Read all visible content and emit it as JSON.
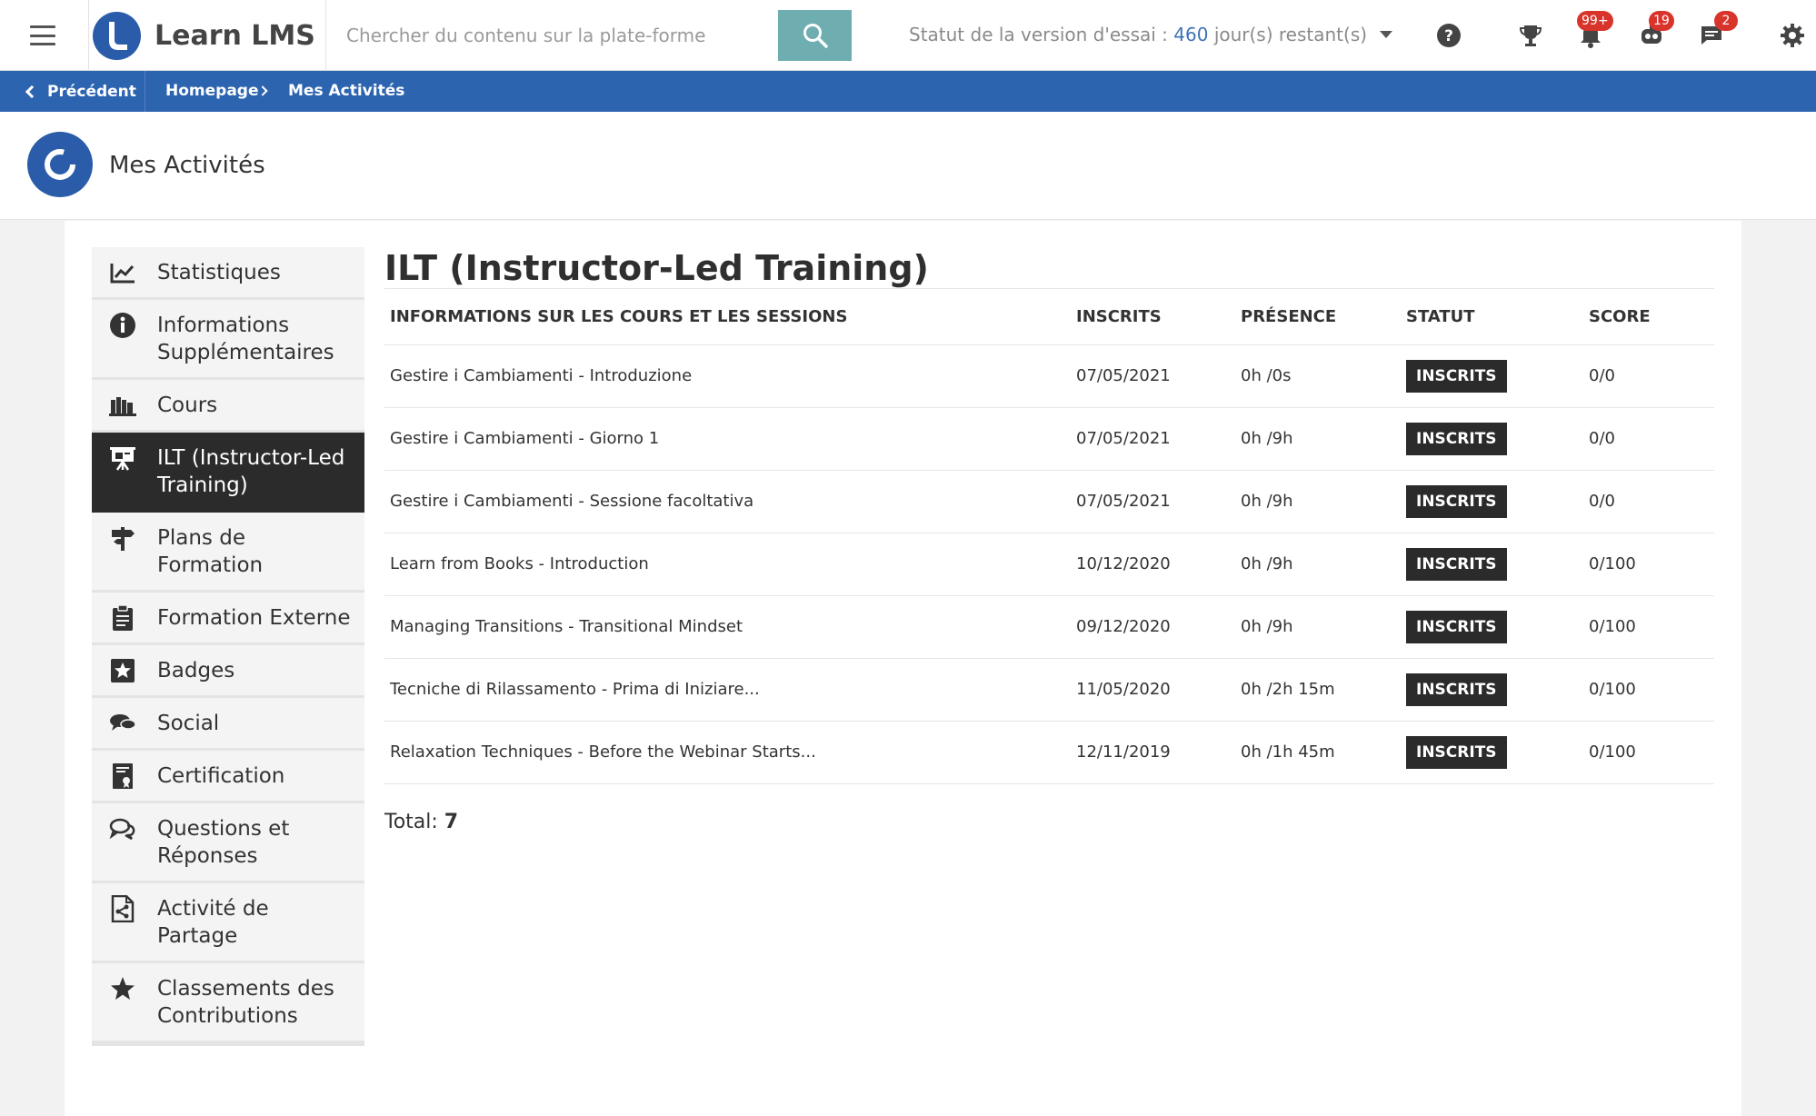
{
  "header": {
    "brand": "Learn LMS",
    "search_placeholder": "Chercher du contenu sur la plate-forme",
    "trial_prefix": "Statut de la version d'essai :",
    "trial_days": "460",
    "trial_suffix": "jour(s) restant(s)",
    "notif_badges": {
      "bell": "99+",
      "robot": "19",
      "chat": "2"
    },
    "icons": [
      "menu-icon",
      "help-icon",
      "trophy-icon",
      "bell-icon",
      "robot-icon",
      "chat-icon",
      "gear-icon"
    ]
  },
  "breadcrumb": {
    "back": "Précédent",
    "home": "Homepage",
    "current": "Mes Activités"
  },
  "page": {
    "title": "Mes Activités"
  },
  "sidebar": {
    "items": [
      {
        "label": "Statistiques",
        "icon": "chart-line-icon"
      },
      {
        "label": "Informations Supplémentaires",
        "icon": "info-icon"
      },
      {
        "label": "Cours",
        "icon": "books-icon"
      },
      {
        "label": "ILT (Instructor-Led Training)",
        "icon": "presentation-icon"
      },
      {
        "label": "Plans de Formation",
        "icon": "signpost-icon"
      },
      {
        "label": "Formation Externe",
        "icon": "clipboard-icon"
      },
      {
        "label": "Badges",
        "icon": "star-badge-icon"
      },
      {
        "label": "Social",
        "icon": "speech-bubbles-icon"
      },
      {
        "label": "Certification",
        "icon": "certificate-icon"
      },
      {
        "label": "Questions et Réponses",
        "icon": "qa-bubbles-icon"
      },
      {
        "label": "Activité de Partage",
        "icon": "share-document-icon"
      },
      {
        "label": "Classements des Contributions",
        "icon": "star-icon"
      }
    ],
    "active_index": 3
  },
  "main": {
    "title": "ILT (Instructor-Led Training)",
    "columns": [
      "INFORMATIONS SUR LES COURS ET LES SESSIONS",
      "INSCRITS",
      "PRÉSENCE",
      "STATUT",
      "SCORE"
    ],
    "rows": [
      {
        "course": "Gestire i Cambiamenti - Introduzione",
        "enrolled": "07/05/2021",
        "presence": "0h /0s",
        "status": "INSCRITS",
        "score": "0/0"
      },
      {
        "course": "Gestire i Cambiamenti - Giorno 1",
        "enrolled": "07/05/2021",
        "presence": "0h /9h",
        "status": "INSCRITS",
        "score": "0/0"
      },
      {
        "course": "Gestire i Cambiamenti - Sessione facoltativa",
        "enrolled": "07/05/2021",
        "presence": "0h /9h",
        "status": "INSCRITS",
        "score": "0/0"
      },
      {
        "course": "Learn from Books - Introduction",
        "enrolled": "10/12/2020",
        "presence": "0h /9h",
        "status": "INSCRITS",
        "score": "0/100"
      },
      {
        "course": "Managing Transitions - Transitional Mindset",
        "enrolled": "09/12/2020",
        "presence": "0h /9h",
        "status": "INSCRITS",
        "score": "0/100"
      },
      {
        "course": "Tecniche di Rilassamento - Prima di Iniziare...",
        "enrolled": "11/05/2020",
        "presence": "0h /2h 15m",
        "status": "INSCRITS",
        "score": "0/100"
      },
      {
        "course": "Relaxation Techniques - Before the Webinar Starts...",
        "enrolled": "12/11/2019",
        "presence": "0h /1h 45m",
        "status": "INSCRITS",
        "score": "0/100"
      }
    ],
    "total_label": "Total:",
    "total_value": "7"
  },
  "colors": {
    "brand_blue": "#2a5caa",
    "breadcrumb_bar": "#2d64b0",
    "search_button": "#6eadb0",
    "badge_red": "#d9342b",
    "active_dark": "#2b2b2b"
  }
}
